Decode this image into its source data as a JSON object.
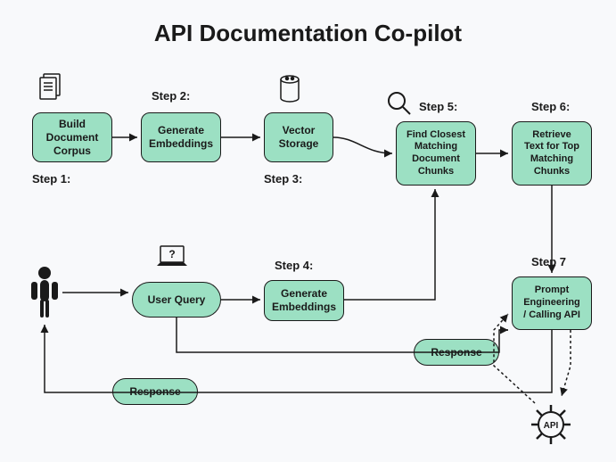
{
  "title": "API Documentation Co-pilot",
  "steps": {
    "s1": {
      "label": "Step 1:",
      "node": "Build\nDocument\nCorpus"
    },
    "s2": {
      "label": "Step 2:",
      "node": "Generate\nEmbeddings"
    },
    "s3": {
      "label": "Step 3:",
      "node": "Vector\nStorage"
    },
    "s4": {
      "label": "Step 4:",
      "node": "Generate\nEmbeddings"
    },
    "s5": {
      "label": "Step 5:",
      "node": "Find Closest\nMatching\nDocument\nChunks"
    },
    "s6": {
      "label": "Step 6:",
      "node": "Retrieve\nText for Top\nMatching\nChunks"
    },
    "s7": {
      "label": "Step 7",
      "node": "Prompt\nEngineering\n/ Calling API"
    }
  },
  "userQuery": "User Query",
  "responseLabel": "Response",
  "icons": {
    "documents": "documents-icon",
    "database": "database-icon",
    "magnifier": "magnifier-icon",
    "person": "person-icon",
    "laptopQuestion": "laptop-question-icon",
    "apiGear": "api-gear-icon"
  },
  "colors": {
    "node": "#9ce0c3",
    "stroke": "#1a1a1a",
    "bg": "#f8f9fb"
  }
}
